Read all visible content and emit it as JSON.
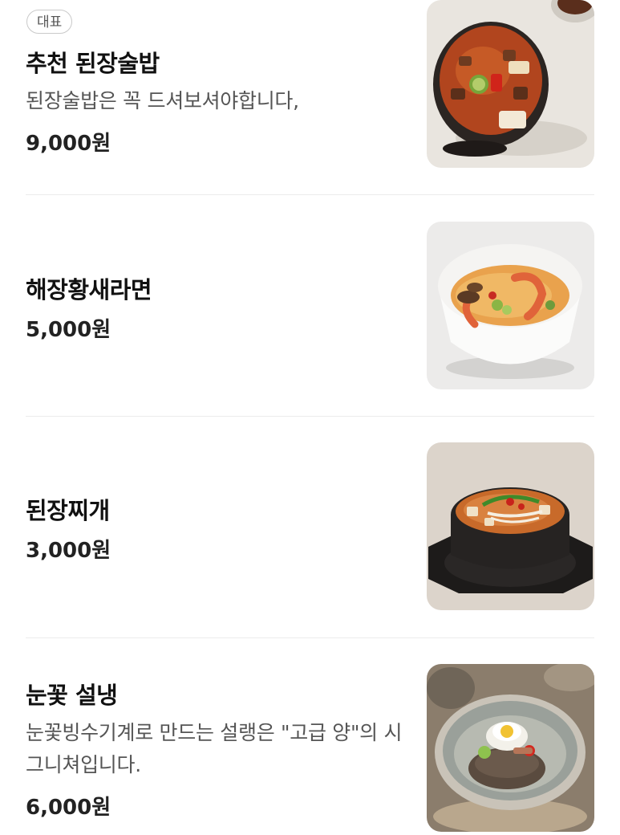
{
  "menu": {
    "items": [
      {
        "badge": "대표",
        "name": "추천 된장술밥",
        "description": "된장술밥은 꼭 드셔보셔야합니다,",
        "price": "9,000원",
        "image": "doenjang-sulbap-photo"
      },
      {
        "name": "해장황새라면",
        "price": "5,000원",
        "image": "shrimp-ramen-photo"
      },
      {
        "name": "된장찌개",
        "price": "3,000원",
        "image": "doenjang-jjigae-photo"
      },
      {
        "name": "눈꽃 설냉",
        "description": "눈꽃빙수기계로 만드는 설랭은 \"고급 양\"의 시그니쳐입니다.",
        "price": "6,000원",
        "image": "naengmyeon-photo"
      }
    ]
  },
  "colors": {
    "text_primary": "#111111",
    "text_secondary": "#555555",
    "divider": "#ececec",
    "badge_border": "#c9c9c9"
  }
}
